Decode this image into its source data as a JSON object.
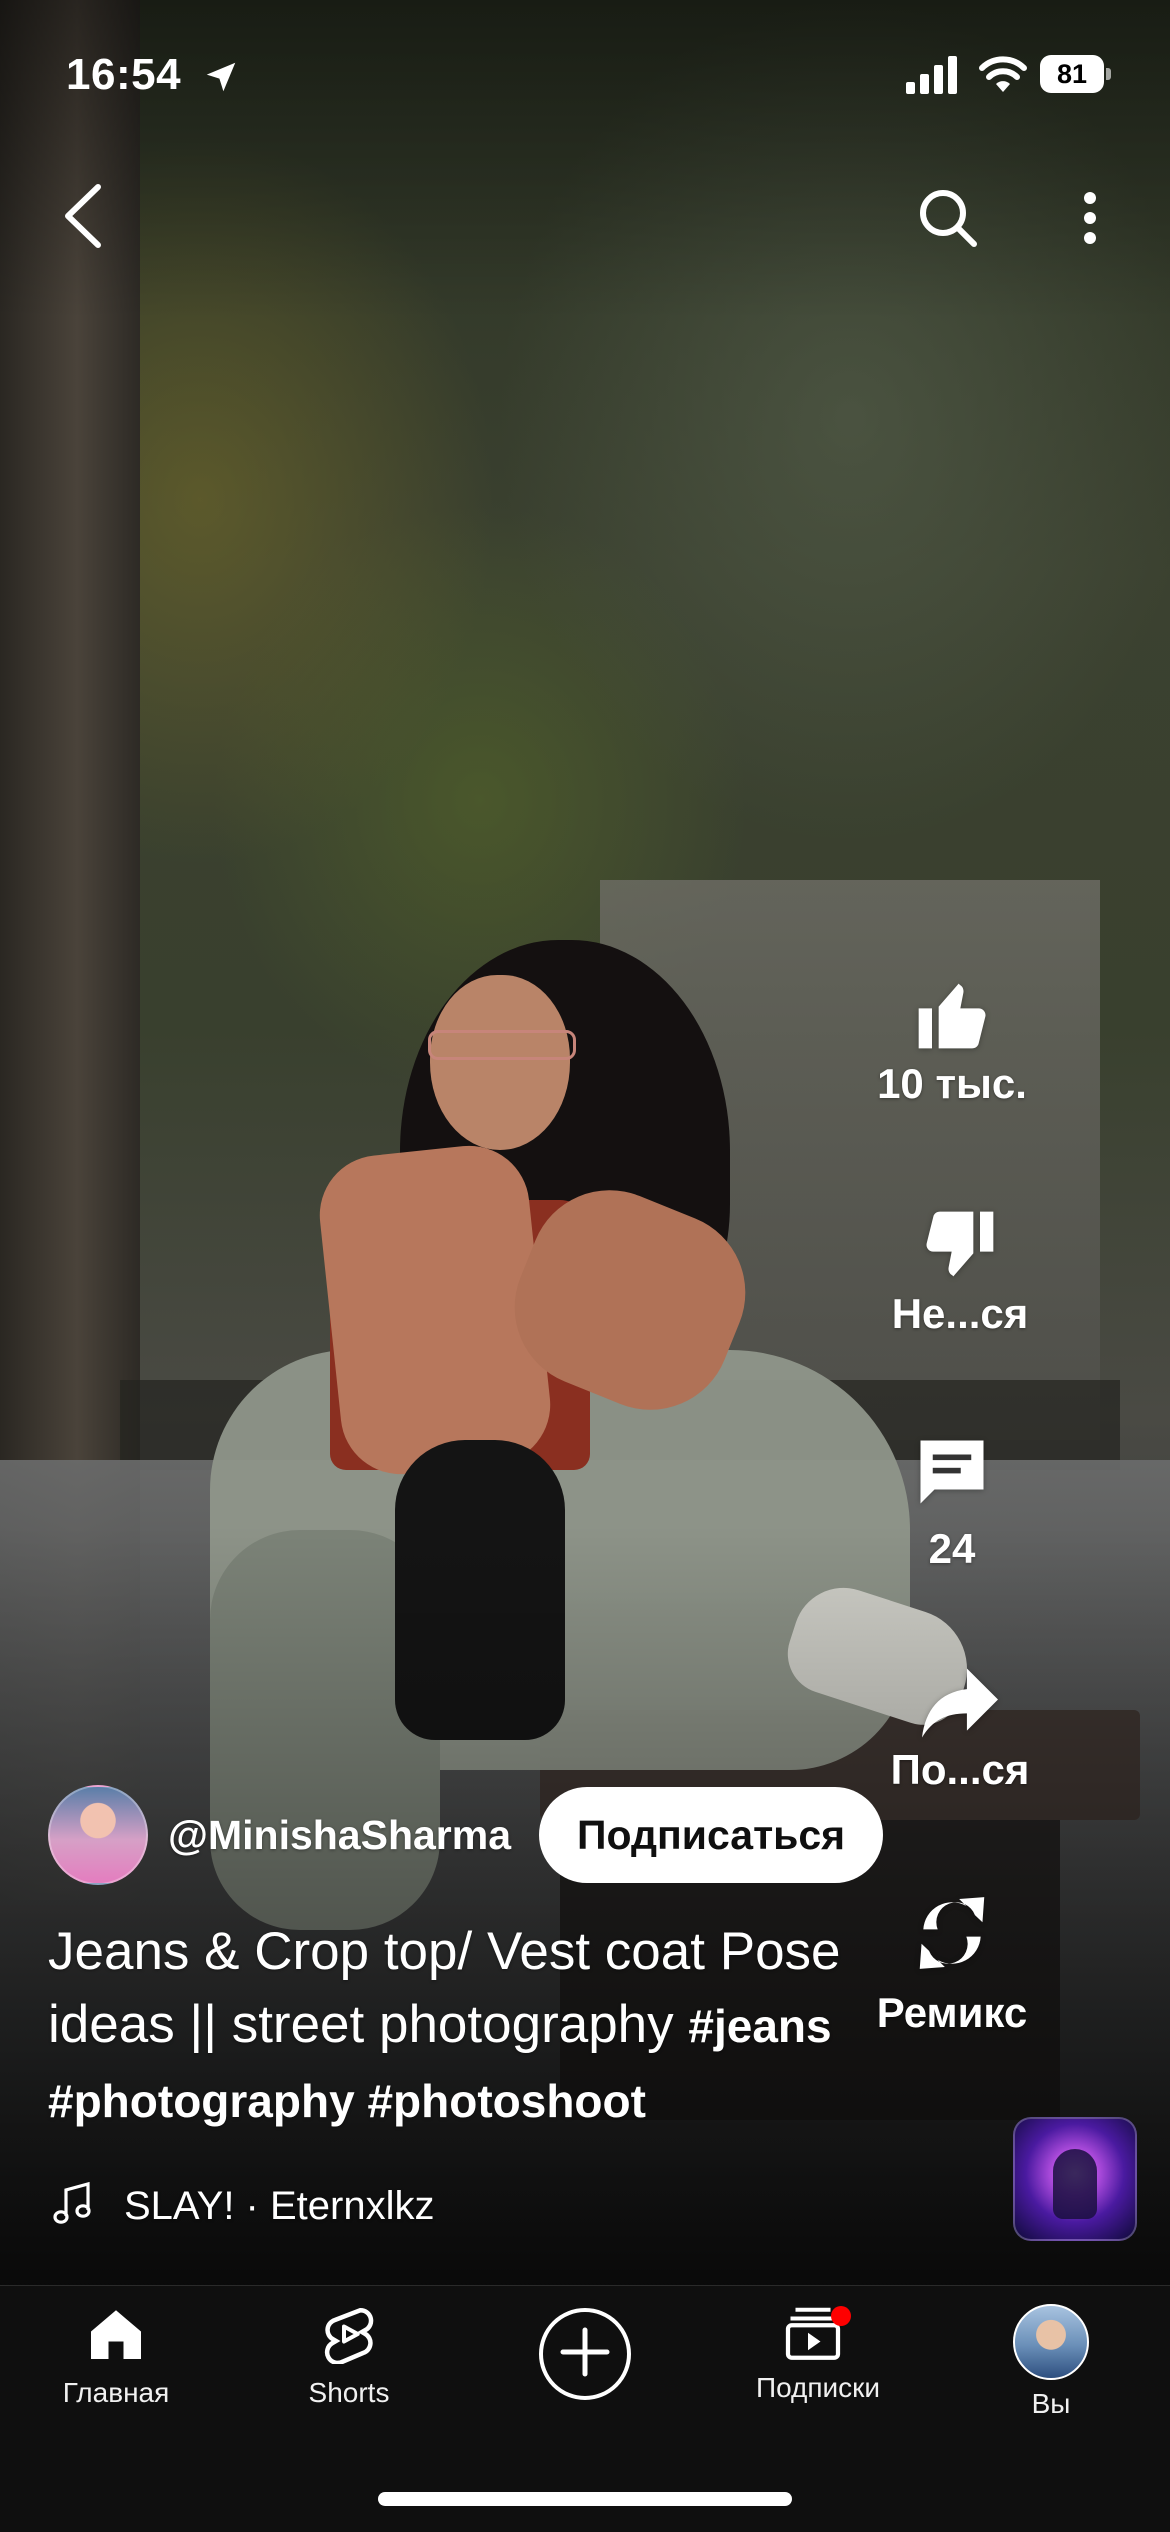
{
  "status_bar": {
    "time": "16:54",
    "battery": "81",
    "icons": [
      "location-arrow-icon",
      "signal-icon",
      "wifi-icon",
      "battery-icon"
    ]
  },
  "top_nav": {
    "icons": [
      "back-arrow-icon",
      "search-icon",
      "more-vertical-icon"
    ]
  },
  "actions": {
    "like_count": "10 тыс.",
    "dislike_label": "Не...ся",
    "comments_count": "24",
    "share_label": "По...ся",
    "remix_label": "Ремикс"
  },
  "channel": {
    "handle": "@MinishaSharma",
    "subscribe_label": "Подписаться"
  },
  "video": {
    "title": "Jeans & Crop top/ Vest coat Pose ideas || street photography",
    "hashtags": "#jeans #photography #photoshoot"
  },
  "music": {
    "text": "SLAY! · Eternxlkz"
  },
  "bottom_nav": {
    "home": "Главная",
    "shorts": "Shorts",
    "subscriptions": "Подписки",
    "you": "Вы"
  },
  "colors": {
    "subscribe_bg": "#ffffff",
    "notification_dot": "#ff0000",
    "nav_bg": "#0f0f0f"
  }
}
